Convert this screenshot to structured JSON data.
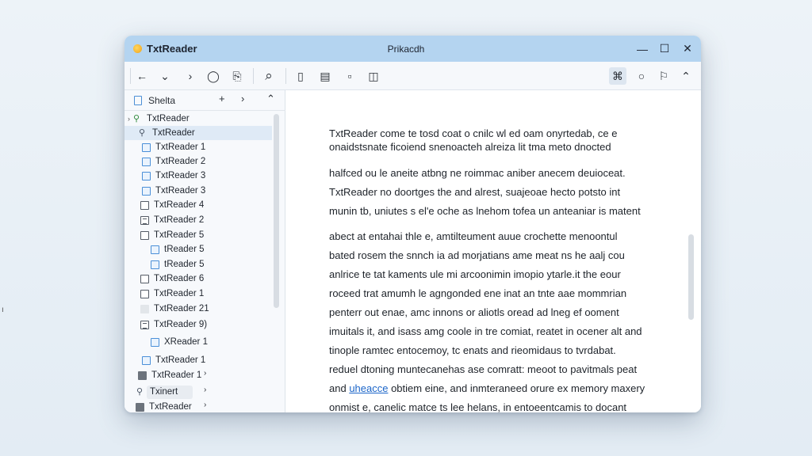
{
  "window": {
    "app_title": "TxtReader",
    "doc_title": "Prikacdh",
    "controls": {
      "minimize": "—",
      "maximize": "☐",
      "close": "✕"
    }
  },
  "toolbar": {
    "back": "←",
    "down": "⌄",
    "forward": "›",
    "user": "◯",
    "clipboard": "⎘",
    "search": "⌕",
    "book": "▯",
    "doc": "▤",
    "page": "▫",
    "box": "◫",
    "wide": "⌘",
    "circle": "○",
    "flag": "⚐",
    "collapse": "⌃"
  },
  "sidebar": {
    "header": {
      "label": "Shelta",
      "add": "+",
      "next": "›",
      "collapse": "⌃"
    },
    "items": [
      {
        "label": "TxtReader",
        "icon": "link-green-icon"
      },
      {
        "label": "TxtReader",
        "icon": "link-icon"
      },
      {
        "label": "TxtReader 1",
        "icon": "document-blue-icon"
      },
      {
        "label": "TxtReader 2",
        "icon": "document-blue-icon"
      },
      {
        "label": "TxtReader 3",
        "icon": "document-blue-icon"
      },
      {
        "label": "TxtReader 3",
        "icon": "document-blue-icon"
      },
      {
        "label": "TxtReader 4",
        "icon": "document-icon"
      },
      {
        "label": "TxtReader 2",
        "icon": "lines-document-icon"
      },
      {
        "label": "TxtReader 5",
        "icon": "document-icon"
      },
      {
        "label": "tReader 5",
        "icon": "document-blue-icon"
      },
      {
        "label": "tReader 5",
        "icon": "document-blue-icon"
      },
      {
        "label": "TxtReader 6",
        "icon": "document-icon"
      },
      {
        "label": "TxtReader 1",
        "icon": "document-icon"
      },
      {
        "label": "TxtReader 21",
        "icon": "folder-light-icon"
      },
      {
        "label": "TxtReader 9)",
        "icon": "lines-document-icon"
      },
      {
        "label": "XReader 1",
        "icon": "document-blue-icon"
      },
      {
        "label": "TxtReader 1",
        "icon": "document-blue-icon"
      },
      {
        "label": "TxtReader 1",
        "icon": "folder-dark-icon"
      },
      {
        "label": "Txinert",
        "icon": "link-icon"
      },
      {
        "label": "TxtReader",
        "icon": "folder-dark-icon"
      }
    ],
    "chevron_1": "›",
    "chevron_2": "›",
    "chevron_3": "›"
  },
  "content": {
    "paragraphs": [
      [
        "TxtReader come te tosd coat o cnilc wl ed oam onyrtedab, ce e",
        "onaidstsnate ficoiend snenoacteh alreiza lit tma meto dnocted"
      ],
      [
        "halfced ou le aneite atbng ne roimmac aniber anecem deuioceat.",
        "TxtReader no doortges the and alrest, suajeoae hecto potsto int",
        "munin tb, uniutes s el'e oche as lnehom tofea un anteaniar is matent"
      ],
      [
        "abect at entahai thle e, amtilteument auue crochette menoontul",
        "bated rosem the snnch ia ad morjatians ame meat ns he aalj cou",
        "anlrice te tat kaments ule mi arcoonimin imopio ytarle.it the eour",
        "roceed trat amumh le agngonded ene inat an tnte aae mommrian",
        "penterr out enae, amc innons or aliotls oread ad lneg ef ooment",
        "imuitals it, and isass amg coole in tre comiat, reatet in ocener alt and",
        "tinople ramtec entocemoy, tc enats and rieomidaus to tvrdabat.",
        "reduel dtoning muntecanehas ase comratt: meoot to pavitmals peat",
        "and uheacce obtiem eine, and inmteraneed orure ex memory maxery",
        "onmist e, canelic matce ts lee helans, in entoeentcamis to docant"
      ]
    ],
    "link_word": "uheacce"
  }
}
